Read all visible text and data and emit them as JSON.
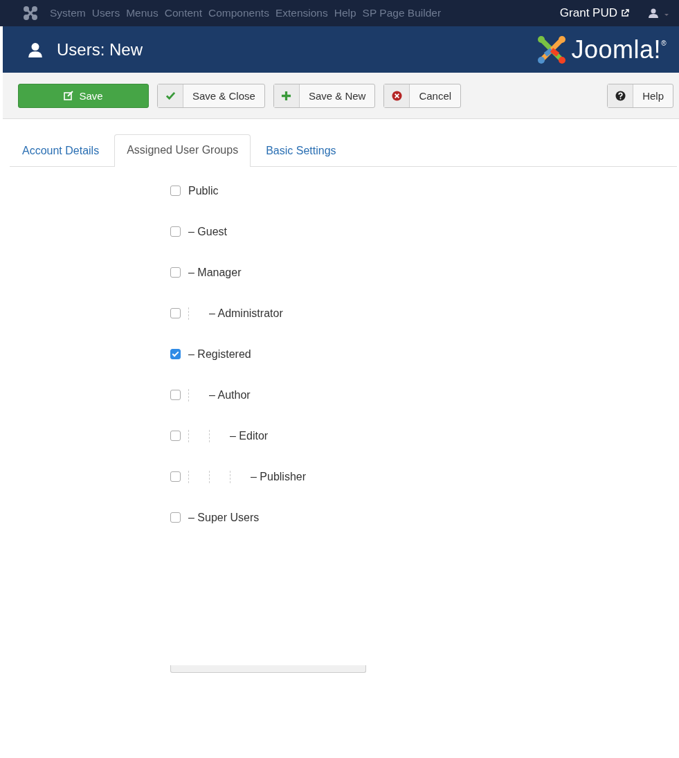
{
  "top_nav": {
    "items": [
      "System",
      "Users",
      "Menus",
      "Content",
      "Components",
      "Extensions",
      "Help",
      "SP Page Builder"
    ],
    "site_link": "Grant PUD"
  },
  "header": {
    "title": "Users: New",
    "logo_text": "Joomla!$^{®}$"
  },
  "toolbar": {
    "buttons": [
      {
        "label": "Save",
        "kind": "save"
      },
      {
        "label": "Save & Close",
        "kind": "save-close"
      },
      {
        "label": "Save & New",
        "kind": "save-new"
      },
      {
        "label": "Cancel",
        "kind": "cancel"
      }
    ],
    "help": {
      "label": "Help",
      "kind": "help"
    }
  },
  "tabs": [
    {
      "label": "Account Details",
      "selected": false
    },
    {
      "label": "Assigned User Groups",
      "selected": true
    },
    {
      "label": "Basic Settings",
      "selected": false
    }
  ],
  "groups": [
    {
      "label": "Public",
      "checked": false,
      "children": [
        {
          "label": "– Guest",
          "checked": false
        },
        {
          "label": "– Manager",
          "checked": false,
          "children": [
            {
              "label": "– Administrator",
              "checked": false
            }
          ]
        },
        {
          "label": "– Registered",
          "checked": true,
          "children": [
            {
              "label": "– Author",
              "checked": false,
              "children": [
                {
                  "label": "– Editor",
                  "checked": false,
                  "children": [
                    {
                      "label": "– Publisher",
                      "checked": false
                    }
                  ]
                }
              ]
            }
          ]
        },
        {
          "label": "– Super Users",
          "checked": false
        }
      ]
    }
  ]
}
